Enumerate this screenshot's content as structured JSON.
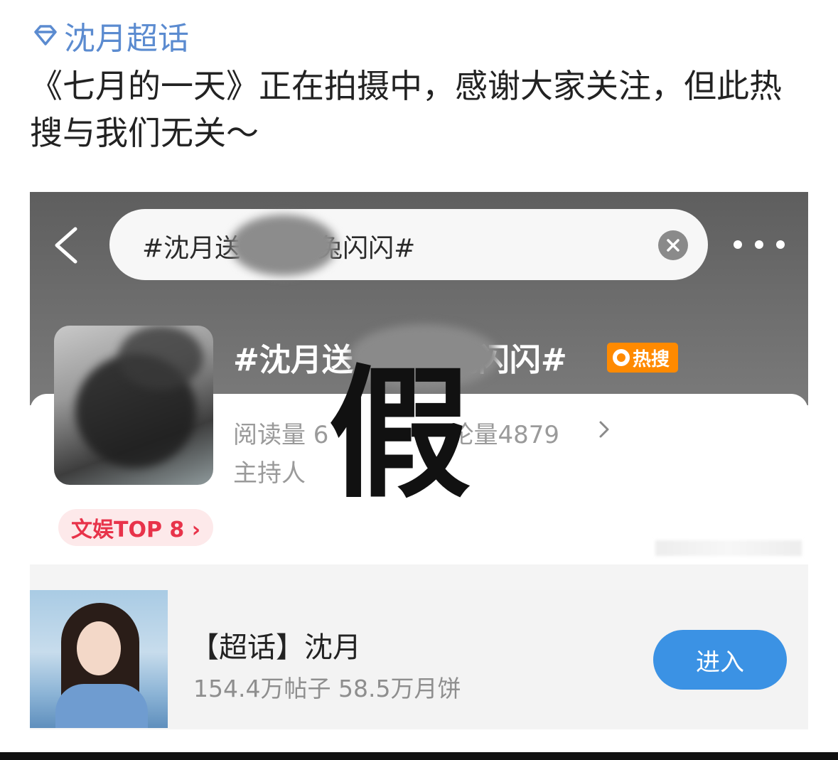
{
  "post": {
    "topic_tag": "沈月超话",
    "text": "《七月的一天》正在拍摄中，感谢大家关注，但此热搜与我们无关～"
  },
  "screenshot": {
    "search": {
      "query": "#沈月送　　　兔闪闪#"
    },
    "topic": {
      "title": "#沈月送　　　兔闪闪#",
      "hot_badge": "热搜",
      "stats": "阅读量 6",
      "stats_tail": "论量4879",
      "host": "主持人",
      "rank": "文娱TOP 8 ›"
    },
    "stamp": "假",
    "chaohua": {
      "title": "【超话】沈月",
      "stats": "154.4万帖子 58.5万月饼",
      "enter_label": "进入"
    }
  },
  "colors": {
    "topic_tag": "#5b8bd0",
    "hot_badge": "#ff8a00",
    "rank_badge": "#e8334a",
    "enter_button": "#3b92e4"
  }
}
